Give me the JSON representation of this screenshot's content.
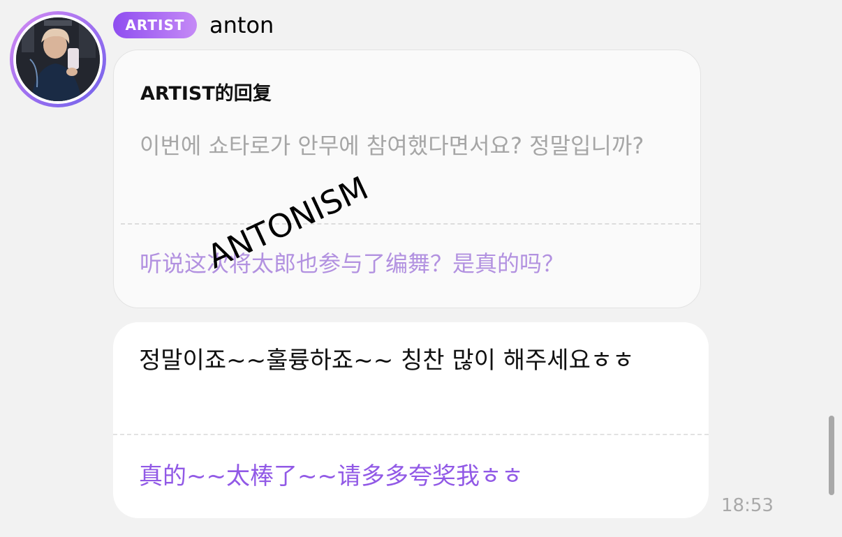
{
  "header": {
    "badge": "ARTIST",
    "name": "anton"
  },
  "avatar": {
    "icon": "profile-photo"
  },
  "reply_card": {
    "title": "ARTIST的回复",
    "original_text": "이번에 쇼타로가 안무에 참여했다면서요? 정말입니까?",
    "translation": "听说这次将太郎也参与了编舞？是真的吗？"
  },
  "watermark": "ANTONISM",
  "message": {
    "original_text": "정말이죠~~훌륭하죠~~ 칭찬 많이 해주세요ㅎㅎ",
    "translation": "真的~~太棒了~~请多多夸奖我ㅎㅎ"
  },
  "timestamp": "18:53",
  "colors": {
    "accent": "#9159e6",
    "badge_gradient_start": "#8f4ef0",
    "badge_gradient_end": "#c58af6",
    "translation_muted": "#b291e0",
    "background": "#f2f2f2"
  }
}
